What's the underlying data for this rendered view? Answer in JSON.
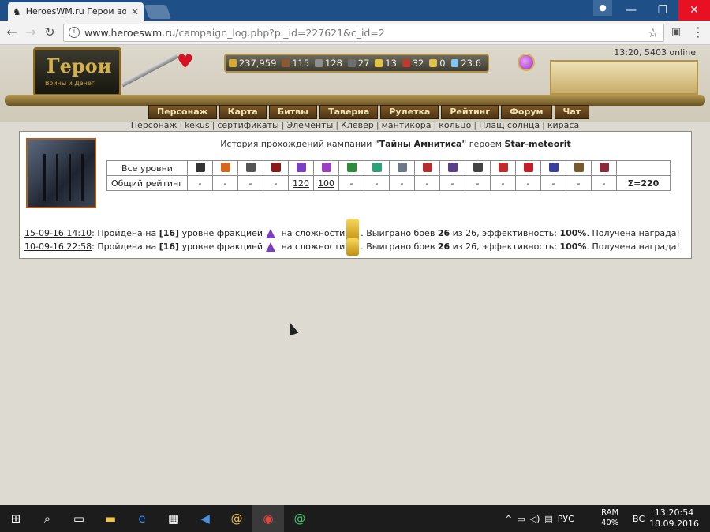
{
  "browser": {
    "tab_title": "HeroesWM.ru Герои вой",
    "url_host": "www.heroeswm.ru",
    "url_path": "/campaign_log.php?pl_id=227621&c_id=2"
  },
  "header": {
    "logo_title": "Герои",
    "logo_subtitle": "Войны и Денег",
    "online": "13:20, 5403 online",
    "resources": [
      "237,959",
      "115",
      "128",
      "27",
      "13",
      "32",
      "0",
      "23.6"
    ],
    "resource_colors": [
      "#d9a930",
      "#8a5a2e",
      "#8e8e8e",
      "#6e6e6e",
      "#e6c33a",
      "#c0392b",
      "#e0c14a",
      "#7fc6f0"
    ],
    "menu": [
      "Персонаж",
      "Карта",
      "Битвы",
      "Таверна",
      "Рулетка",
      "Рейтинг",
      "Форум",
      "Чат"
    ]
  },
  "submenu": [
    "Персонаж",
    "kekus",
    "сертификаты",
    "Элементы",
    "Клевер",
    "мантикора",
    "кольцо",
    "Плащ солнца",
    "кираса"
  ],
  "campaign": {
    "title_prefix": "История прохождений кампании ",
    "title_name": "\"Тайны Амнитиса\"",
    "title_mid": " героем ",
    "hero": "Star-meteorit",
    "levels_label": "Все уровни",
    "rating_label": "Общий рейтинг",
    "faction_icons": [
      "cross-icon",
      "knight-icon",
      "helmet-icon",
      "dark-icon",
      "hat-violet-icon",
      "hat-purple-icon",
      "leaf-icon",
      "leaf2-icon",
      "sword-icon",
      "sword-red-icon",
      "sword-dark-icon",
      "dragon-icon",
      "mask-icon",
      "star-icon",
      "orb-icon",
      "hammer-icon",
      "beast-icon"
    ],
    "faction_colors": [
      "#333333",
      "#d2691e",
      "#555555",
      "#8b1a1a",
      "#7a3fbf",
      "#9b3fbf",
      "#2e8b3a",
      "#2aa37a",
      "#6a7a8a",
      "#b03030",
      "#5a3f8a",
      "#444444",
      "#c02a2a",
      "#c0202a",
      "#3a3f9a",
      "#7a5a2a",
      "#8a2a3a"
    ],
    "ratings": [
      "-",
      "-",
      "-",
      "-",
      "120",
      "100",
      "-",
      "-",
      "-",
      "-",
      "-",
      "-",
      "-",
      "-",
      "-",
      "-",
      "-"
    ],
    "total": "Σ=220",
    "log": [
      {
        "date": "15-09-16 14:10",
        "t1": ": Пройдена на ",
        "level": "[16]",
        "t2": " уровне фракцией",
        "t3": " на сложности",
        "t4": ". Выиграно боев ",
        "won": "26",
        "t5": " из 26, эффективность: ",
        "eff": "100%",
        "t6": ". Получена награда!"
      },
      {
        "date": "10-09-16 22:58",
        "t1": ": Пройдена на ",
        "level": "[16]",
        "t2": " уровне фракцией",
        "t3": " на сложности",
        "t4": ". Выиграно боев ",
        "won": "26",
        "t5": " из 26, эффективность: ",
        "eff": "100%",
        "t6": ". Получена награда!"
      }
    ]
  },
  "taskbar": {
    "lang": "РУС",
    "ram_label": "RAM",
    "ram_value": "40%",
    "day": "ВС",
    "time": "13:20:54",
    "date": "18.09.2016"
  }
}
